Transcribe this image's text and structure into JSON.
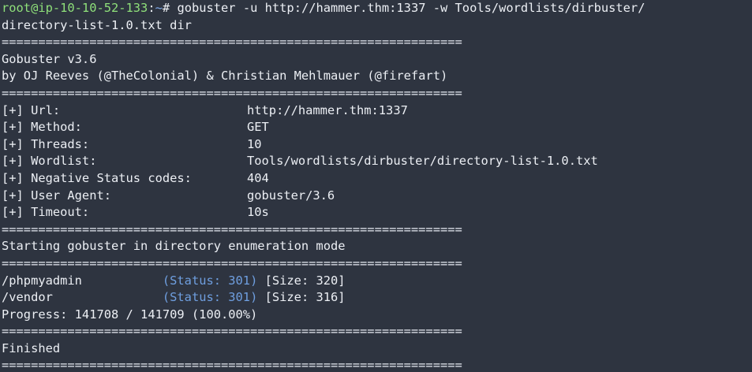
{
  "colors": {
    "background": "#2e3440",
    "prompt_user": "#8fe07a",
    "prompt_path": "#7ea8e8",
    "status": "#6f9fe0",
    "text": "#eceff4"
  },
  "prompt": {
    "user_host": "root@ip-10-10-52-133",
    "colon": ":",
    "path": "~",
    "symbol": "#",
    "command_line1": " gobuster -u http://hammer.thm:1337 -w Tools/wordlists/dirbuster/",
    "command_line2": "directory-list-1.0.txt dir"
  },
  "separator": "===============================================================",
  "banner": {
    "version": "Gobuster v3.6",
    "authors": "by OJ Reeves (@TheColonial) & Christian Mehlmauer (@firefart)"
  },
  "config": [
    {
      "key": "[+] Url:",
      "value": "http://hammer.thm:1337"
    },
    {
      "key": "[+] Method:",
      "value": "GET"
    },
    {
      "key": "[+] Threads:",
      "value": "10"
    },
    {
      "key": "[+] Wordlist:",
      "value": "Tools/wordlists/dirbuster/directory-list-1.0.txt"
    },
    {
      "key": "[+] Negative Status codes:",
      "value": "404"
    },
    {
      "key": "[+] User Agent:",
      "value": "gobuster/3.6"
    },
    {
      "key": "[+] Timeout:",
      "value": "10s"
    }
  ],
  "start_message": "Starting gobuster in directory enumeration mode",
  "results": [
    {
      "path": "/phpmyadmin",
      "padding": "           ",
      "status": "(Status: 301)",
      "size": " [Size: 320]"
    },
    {
      "path": "/vendor",
      "padding": "               ",
      "status": "(Status: 301)",
      "size": " [Size: 316]"
    }
  ],
  "progress": "Progress: 141708 / 141709 (100.00%)",
  "finished": "Finished"
}
